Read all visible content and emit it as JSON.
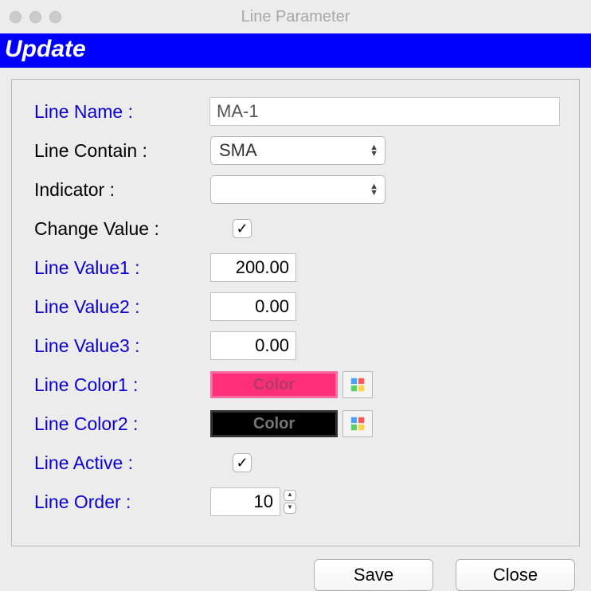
{
  "window": {
    "title": "Line Parameter"
  },
  "header": {
    "title": "Update"
  },
  "form": {
    "line_name": {
      "label": "Line Name :",
      "value": "MA-1"
    },
    "line_contain": {
      "label": "Line Contain :",
      "value": "SMA"
    },
    "indicator": {
      "label": "Indicator :",
      "value": ""
    },
    "change_value": {
      "label": "Change Value :",
      "checked": true
    },
    "line_value1": {
      "label": "Line Value1 :",
      "value": "200.00"
    },
    "line_value2": {
      "label": "Line Value2 :",
      "value": "0.00"
    },
    "line_value3": {
      "label": "Line Value3 :",
      "value": "0.00"
    },
    "line_color1": {
      "label": "Line Color1 :",
      "button": "Color",
      "hex": "#ff2e78"
    },
    "line_color2": {
      "label": "Line Color2 :",
      "button": "Color",
      "hex": "#000000"
    },
    "line_active": {
      "label": "Line Active :",
      "checked": true
    },
    "line_order": {
      "label": "Line Order :",
      "value": "10"
    }
  },
  "buttons": {
    "save": "Save",
    "close": "Close"
  },
  "checkmark": "✓"
}
